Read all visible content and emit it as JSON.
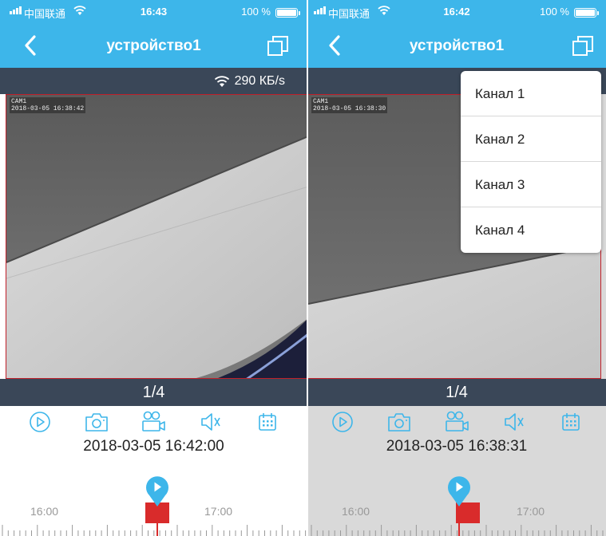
{
  "colors": {
    "accent": "#3db6ea",
    "dark_bar": "#3a4758",
    "record_red": "#d92b2b"
  },
  "panels": [
    {
      "status": {
        "carrier": "中国联通",
        "time": "16:43",
        "battery": "100 %"
      },
      "nav": {
        "title": "устройство1"
      },
      "speed": "290 КБ/s",
      "osd": {
        "cam": "CAM1",
        "stamp": "2018-03-05 16:38:42"
      },
      "page": "1/4",
      "toolbar": [
        "play-icon",
        "snapshot-icon",
        "record-icon",
        "mute-icon",
        "calendar-icon"
      ],
      "datetime": "2018-03-05 16:42:00",
      "timeline": {
        "labels": [
          "16:00",
          "17:00"
        ]
      }
    },
    {
      "status": {
        "carrier": "中国联通",
        "time": "16:42",
        "battery": "100 %"
      },
      "nav": {
        "title": "устройство1"
      },
      "osd": {
        "cam": "CAM1",
        "stamp": "2018-03-05 16:38:30"
      },
      "page": "1/4",
      "toolbar": [
        "play-icon",
        "snapshot-icon",
        "record-icon",
        "mute-icon",
        "calendar-icon"
      ],
      "datetime": "2018-03-05 16:38:31",
      "timeline": {
        "labels": [
          "16:00",
          "17:00"
        ]
      },
      "dropdown": [
        "Канал 1",
        "Канал 2",
        "Канал 3",
        "Канал 4"
      ]
    }
  ]
}
